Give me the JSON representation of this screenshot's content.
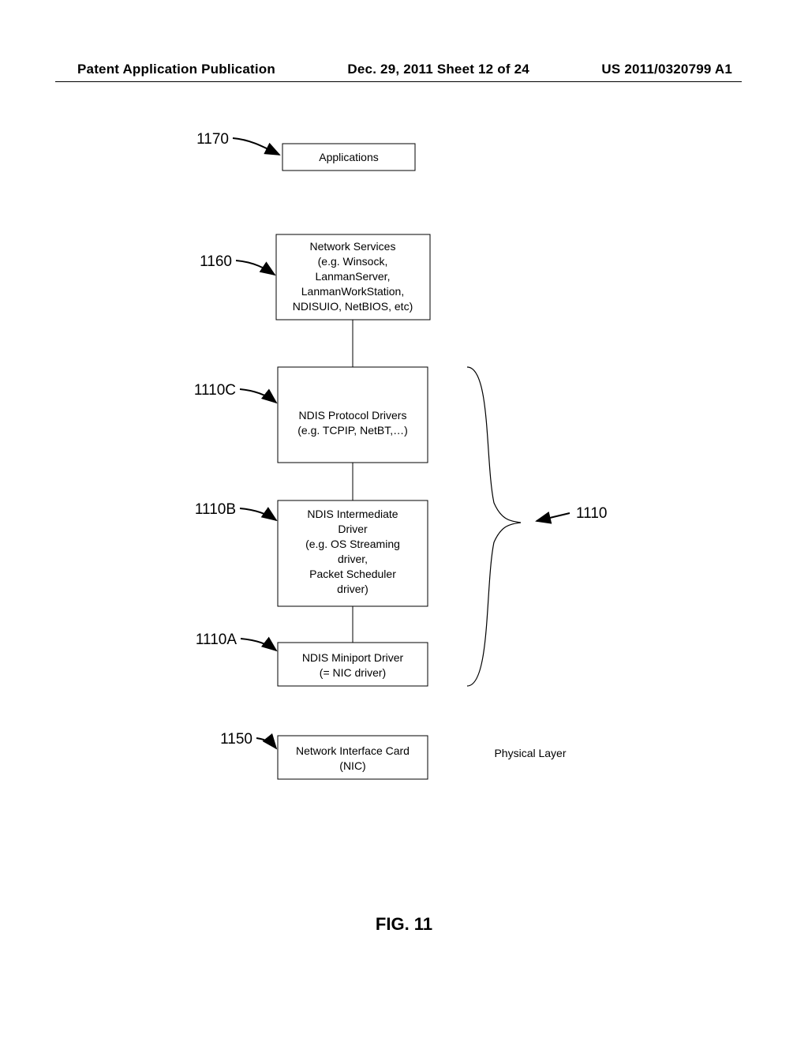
{
  "header": {
    "left": "Patent Application Publication",
    "mid": "Dec. 29, 2011  Sheet 12 of 24",
    "right": "US 2011/0320799 A1"
  },
  "nodes": {
    "applications": "Applications",
    "network_services_l1": "Network Services",
    "network_services_l2": "(e.g. Winsock,",
    "network_services_l3": "LanmanServer,",
    "network_services_l4": "LanmanWorkStation,",
    "network_services_l5": "NDISUIO, NetBIOS, etc)",
    "protocol_l1": "NDIS Protocol Drivers",
    "protocol_l2": "(e.g. TCPIP, NetBT,…)",
    "intermediate_l1": "NDIS Intermediate",
    "intermediate_l2": "Driver",
    "intermediate_l3": "(e.g. OS Streaming",
    "intermediate_l4": "driver,",
    "intermediate_l5": "Packet Scheduler",
    "intermediate_l6": "driver)",
    "miniport_l1": "NDIS Miniport Driver",
    "miniport_l2": "(= NIC driver)",
    "nic_l1": "Network Interface Card",
    "nic_l2": "(NIC)",
    "physical_layer": "Physical Layer"
  },
  "refs": {
    "r1170": "1170",
    "r1160": "1160",
    "r1110C": "1110C",
    "r1110B": "1110B",
    "r1110A": "1110A",
    "r1150": "1150",
    "r1110": "1110"
  },
  "figure_label": "FIG. 11"
}
